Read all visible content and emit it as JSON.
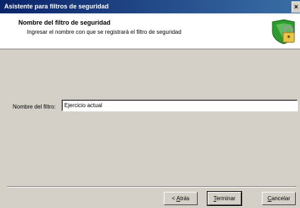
{
  "window": {
    "title": "Asistente para filtros de seguridad",
    "close_glyph": "×"
  },
  "header": {
    "title": "Nombre del filtro de seguridad",
    "subtitle": "Ingresar el nombre con que se registrará el filtro de seguridad",
    "icon": "shield-lock-icon"
  },
  "form": {
    "filter_name_label": "Nombre del filtro:",
    "filter_name_value": "Ejercicio actual"
  },
  "buttons": {
    "back_prefix": "< ",
    "back_mnemonic": "A",
    "back_rest": "trás",
    "finish_mnemonic": "T",
    "finish_rest": "erminar",
    "cancel_mnemonic": "C",
    "cancel_rest": "ancelar"
  }
}
